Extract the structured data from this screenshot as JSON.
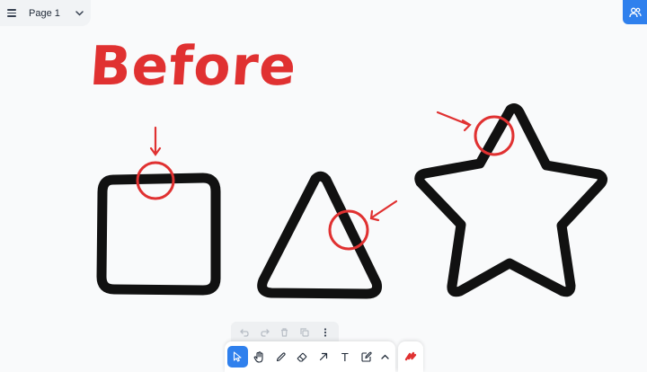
{
  "page_menu": {
    "page_name": "Page 1"
  },
  "canvas": {
    "heading": "Before",
    "accent_color": "#e03131",
    "stroke_color": "#111111"
  },
  "toolbar": {
    "history_actions": [
      "undo-icon",
      "redo-icon",
      "trash-icon",
      "duplicate-icon",
      "more-icon"
    ],
    "tools": [
      "select",
      "hand",
      "draw",
      "eraser",
      "arrow",
      "text",
      "note",
      "more-tools"
    ],
    "active_tool": "select",
    "active_color": "#2f80ed",
    "text_tool_glyph": "T"
  }
}
